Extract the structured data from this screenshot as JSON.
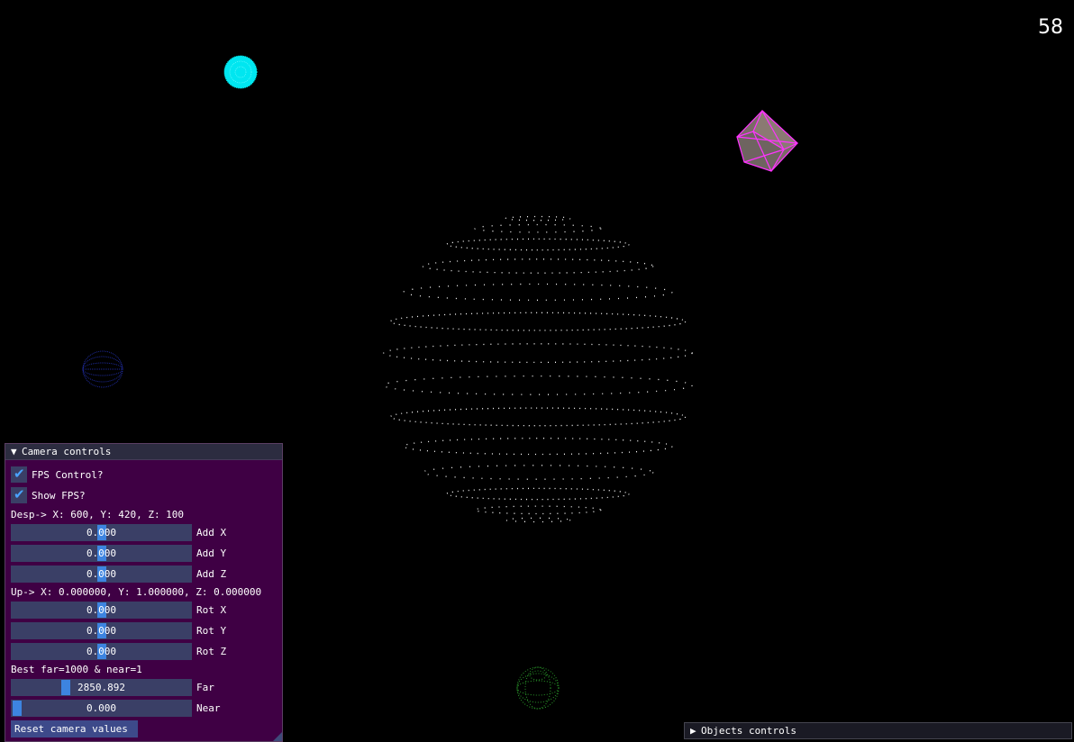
{
  "fps_counter": "58",
  "camera_controls": {
    "title": "Camera controls",
    "fps_control_label": "FPS Control?",
    "fps_control_checked": true,
    "show_fps_label": "Show FPS?",
    "show_fps_checked": true,
    "desp_text": "Desp-> X: 600, Y: 420, Z: 100",
    "add_x": {
      "value": "0.000",
      "label": "Add X"
    },
    "add_y": {
      "value": "0.000",
      "label": "Add Y"
    },
    "add_z": {
      "value": "0.000",
      "label": "Add Z"
    },
    "up_text": "Up-> X: 0.000000, Y: 1.000000, Z: 0.000000",
    "rot_x": {
      "value": "0.000",
      "label": "Rot X"
    },
    "rot_y": {
      "value": "0.000",
      "label": "Rot Y"
    },
    "rot_z": {
      "value": "0.000",
      "label": "Rot Z"
    },
    "best_text": "Best far=1000 & near=1",
    "far": {
      "value": "2850.892",
      "label": "Far"
    },
    "near": {
      "value": "0.000",
      "label": "Near"
    },
    "reset_label": "Reset camera values"
  },
  "objects_controls": {
    "title": "Objects controls"
  },
  "colors": {
    "panel_bg": "#3f0044",
    "title_bg": "#2c2c40",
    "frame_bg": "#3a3f66",
    "accent": "#3d84e0",
    "checkmark": "#4aa3ff"
  },
  "scene_objects": [
    {
      "name": "cyan-sphere",
      "color": "#00ffff"
    },
    {
      "name": "magenta-cube",
      "color": "#ff33ff"
    },
    {
      "name": "white-point-sphere",
      "color": "#ffffff"
    },
    {
      "name": "blue-sphere",
      "color": "#1e2a9a"
    },
    {
      "name": "green-sphere",
      "color": "#2a9a2a"
    }
  ]
}
